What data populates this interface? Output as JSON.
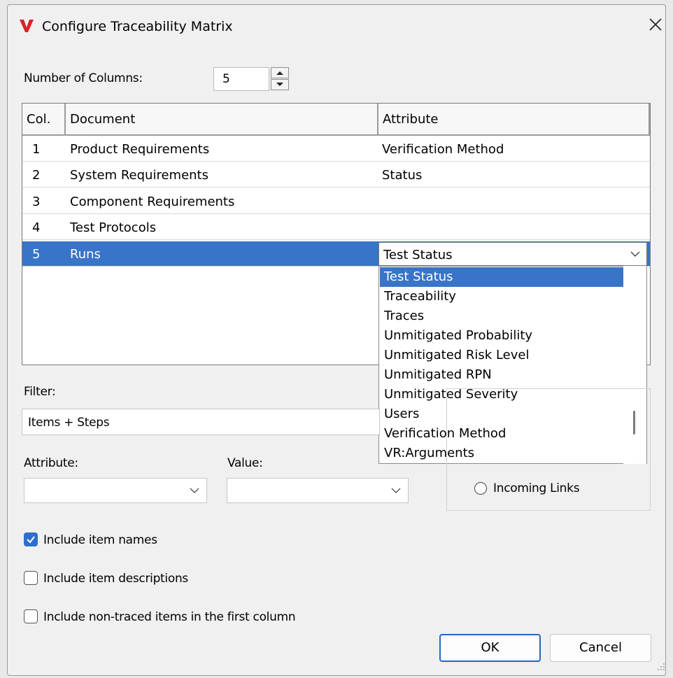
{
  "window": {
    "title": "Configure Traceability Matrix",
    "logo_glyph": "V"
  },
  "columns": {
    "label": "Number of Columns:",
    "value": "5"
  },
  "grid": {
    "headers": [
      "Col.",
      "Document",
      "Attribute"
    ],
    "rows": [
      {
        "col": "1",
        "document": "Product Requirements",
        "attribute": "Verification Method"
      },
      {
        "col": "2",
        "document": "System Requirements",
        "attribute": "Status"
      },
      {
        "col": "3",
        "document": "Component Requirements",
        "attribute": ""
      },
      {
        "col": "4",
        "document": "Test Protocols",
        "attribute": ""
      },
      {
        "col": "5",
        "document": "Runs",
        "attribute": ""
      }
    ],
    "selected_row": 5
  },
  "attribute_dropdown": {
    "value": "Test Status",
    "options": [
      "Test Status",
      "Traceability",
      "Traces",
      "Unmitigated Probability",
      "Unmitigated Risk Level",
      "Unmitigated RPN",
      "Unmitigated Severity",
      "Users",
      "Verification Method",
      "VR:Arguments"
    ],
    "highlighted": "Test Status"
  },
  "filter": {
    "label": "Filter:",
    "value": "Items + Steps",
    "attribute_label": "Attribute:",
    "value_label": "Value:"
  },
  "links": {
    "incoming_label": "Incoming Links"
  },
  "options": {
    "include_names": {
      "label": "Include item names",
      "checked": true
    },
    "include_descriptions": {
      "label": "Include item descriptions",
      "checked": false
    },
    "include_non_traced": {
      "label": "Include non-traced items in the first column",
      "checked": false
    }
  },
  "buttons": {
    "ok": "OK",
    "cancel": "Cancel"
  },
  "colors": {
    "selection": "#3874c8",
    "accent": "#2666c0",
    "logo": "#d8232a"
  }
}
